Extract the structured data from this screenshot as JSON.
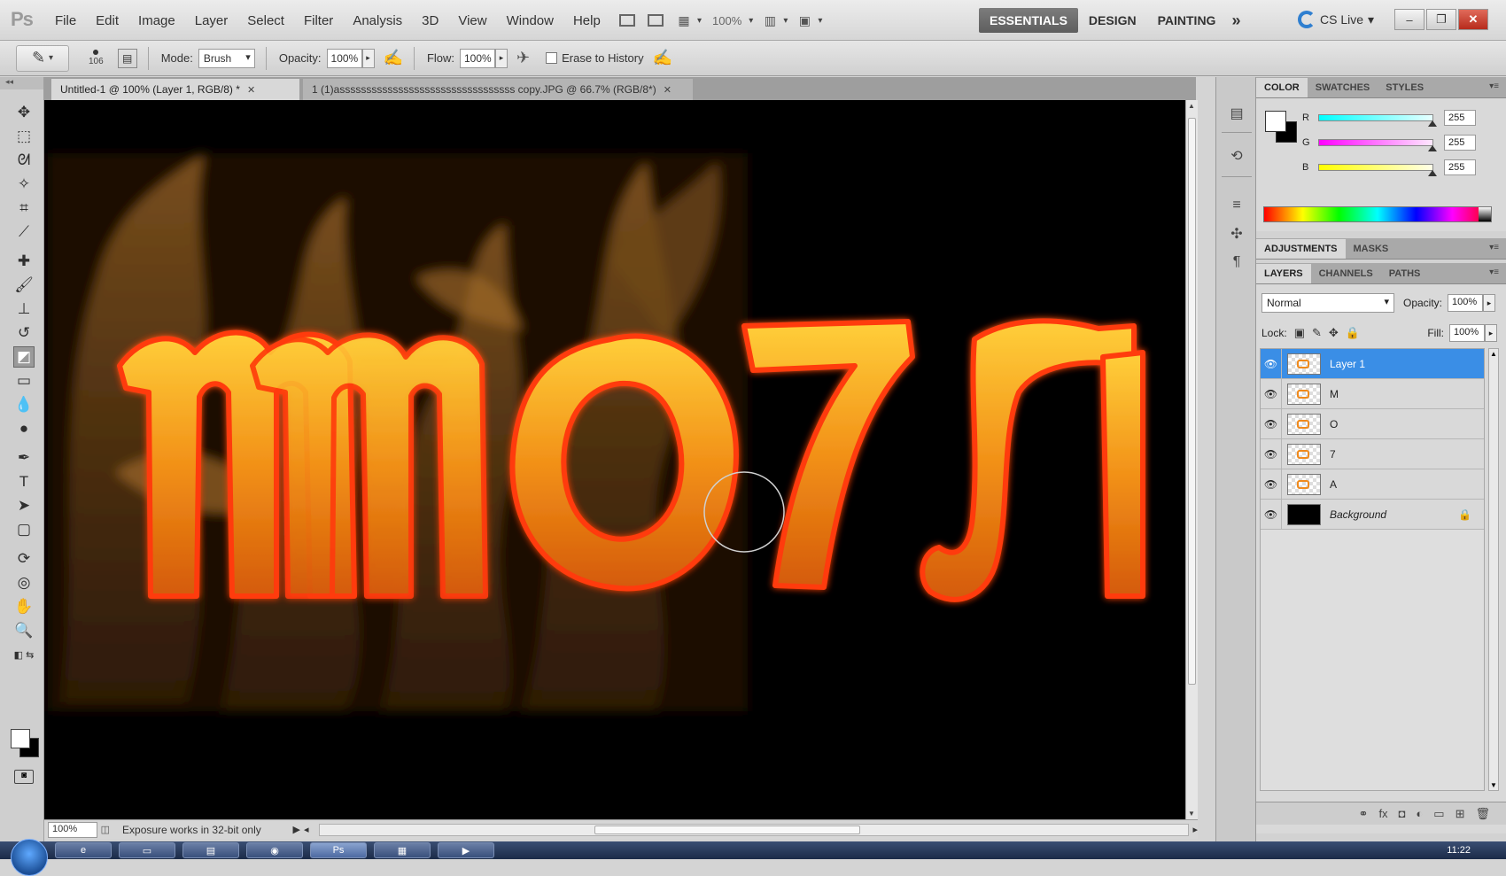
{
  "app": {
    "logo": "Ps"
  },
  "menu": [
    "File",
    "Edit",
    "Image",
    "Layer",
    "Select",
    "Filter",
    "Analysis",
    "3D",
    "View",
    "Window",
    "Help"
  ],
  "menubar": {
    "zoom": "100%",
    "workspaces": [
      "ESSENTIALS",
      "DESIGN",
      "PAINTING"
    ],
    "more": "»",
    "cslive": "CS Live"
  },
  "options": {
    "brush_size": "106",
    "mode_label": "Mode:",
    "mode_value": "Brush",
    "opacity_label": "Opacity:",
    "opacity_value": "100%",
    "flow_label": "Flow:",
    "flow_value": "100%",
    "erase_to_history": "Erase to History"
  },
  "tabs": [
    {
      "label": "Untitled-1 @ 100% (Layer 1, RGB/8) *"
    },
    {
      "label": "1 (1)asssssssssssssssssssssssssssssssss copy.JPG @ 66.7% (RGB/8*)"
    }
  ],
  "status": {
    "zoom": "100%",
    "message": "Exposure works in 32-bit only"
  },
  "panels": {
    "color_tabs": [
      "COLOR",
      "SWATCHES",
      "STYLES"
    ],
    "color": {
      "r_label": "R",
      "r_value": "255",
      "g_label": "G",
      "g_value": "255",
      "b_label": "B",
      "b_value": "255"
    },
    "adj_tabs": [
      "ADJUSTMENTS",
      "MASKS"
    ],
    "layer_tabs": [
      "LAYERS",
      "CHANNELS",
      "PATHS"
    ],
    "layers": {
      "blend_mode": "Normal",
      "opacity_label": "Opacity:",
      "opacity_value": "100%",
      "lock_label": "Lock:",
      "fill_label": "Fill:",
      "fill_value": "100%",
      "items": [
        {
          "name": "Layer 1",
          "selected": true
        },
        {
          "name": "M"
        },
        {
          "name": "O"
        },
        {
          "name": "7"
        },
        {
          "name": "A"
        },
        {
          "name": "Background",
          "locked": true
        }
      ]
    }
  },
  "taskbar": {
    "time": "11:22"
  },
  "colors": {
    "accent": "#3a8ee6",
    "fire": "#f59a1a",
    "canvas": "#000000"
  }
}
